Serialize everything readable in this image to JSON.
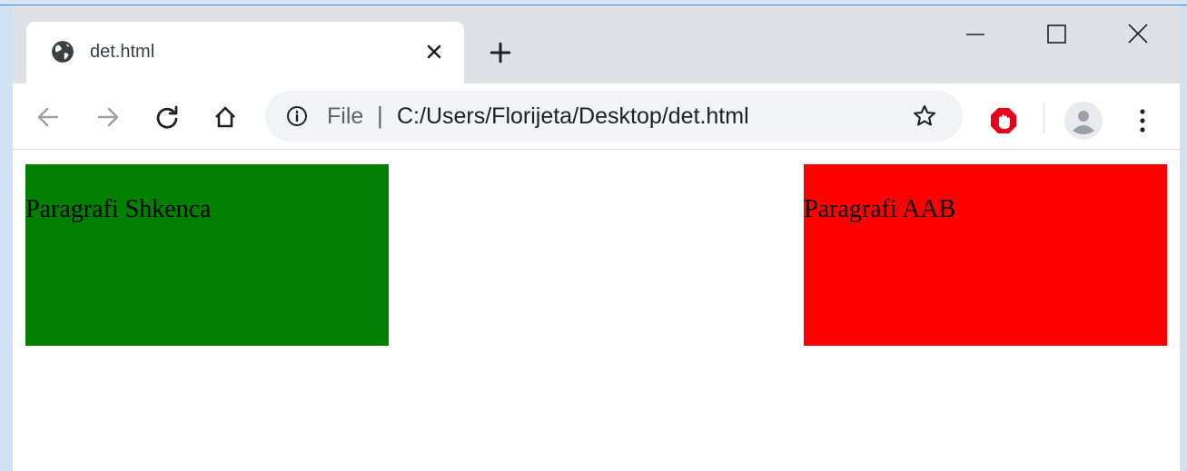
{
  "browser": {
    "tab": {
      "title": "det.html"
    },
    "address": {
      "scheme": "File",
      "separator": "|",
      "url": "C:/Users/Florijeta/Desktop/det.html"
    },
    "icons": {
      "tab_favicon": "globe-icon",
      "tab_close": "close-icon",
      "new_tab": "plus-icon",
      "back": "arrow-left-icon",
      "forward": "arrow-right-icon",
      "reload": "reload-icon",
      "home": "home-icon",
      "info": "info-icon",
      "bookmark": "star-icon",
      "extension": "adblock-hand-icon",
      "profile": "avatar-icon",
      "menu": "kebab-menu-icon",
      "minimize": "minimize-icon",
      "maximize": "maximize-icon",
      "close_window": "close-icon"
    },
    "colors": {
      "tabstrip": "#dee1e6",
      "omnibox": "#f1f3f4",
      "extension": "#e8001f"
    }
  },
  "page": {
    "paragraphs": [
      {
        "text": "Paragrafi Shkenca",
        "background": "#008000"
      },
      {
        "text": "Paragrafi AAB",
        "background": "#ff0000"
      }
    ]
  }
}
